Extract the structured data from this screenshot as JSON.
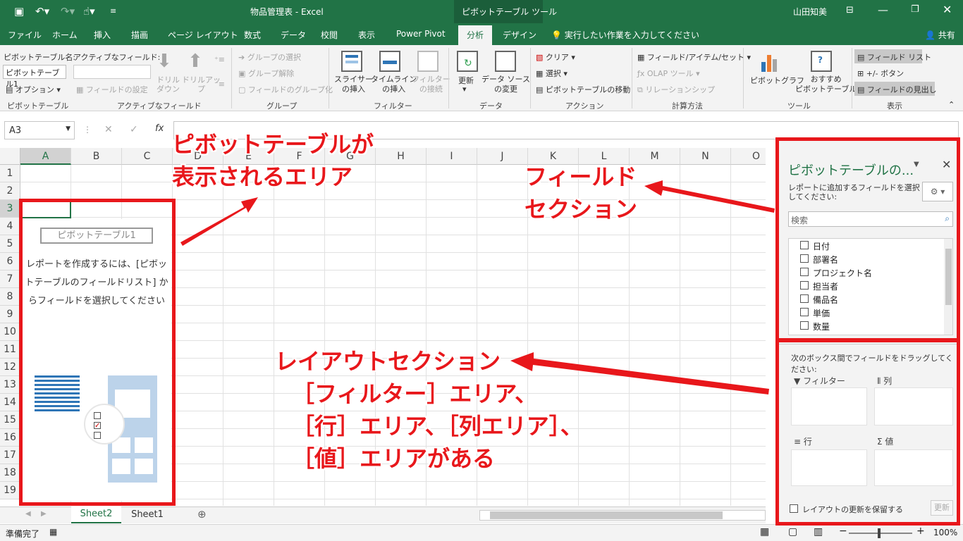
{
  "title": {
    "doc": "物品管理表 - Excel",
    "context": "ピボットテーブル ツール",
    "user": "山田知美"
  },
  "tabs": [
    "ファイル",
    "ホーム",
    "挿入",
    "描画",
    "ページ レイアウト",
    "数式",
    "データ",
    "校閲",
    "表示",
    "Power Pivot",
    "分析",
    "デザイン"
  ],
  "tell_me": "実行したい作業を入力してください",
  "share": "共有",
  "ribbon": {
    "pt_name_label": "ピボットテーブル名:",
    "pt_name_value": "ピボットテーブル1",
    "options": "オプション",
    "active_field_label": "アクティブなフィールド:",
    "field_settings": "フィールドの設定",
    "drill_down": "ドリル\nダウン",
    "drill_up": "ドリルアッ\nプ",
    "group_select": "グループの選択",
    "ungroup": "グループ解除",
    "field_group": "フィールドのグループ化",
    "slicer": "スライサー\nの挿入",
    "timeline": "タイムライン\nの挿入",
    "filter_conn": "フィルター\nの接続",
    "refresh": "更新",
    "change_source": "データ ソース\nの変更",
    "clear": "クリア",
    "select": "選択",
    "move_pt": "ピボットテーブルの移動",
    "fields_items_sets": "フィールド/アイテム/セット",
    "olap_tools": "OLAP ツール",
    "relationships": "リレーションシップ",
    "pivot_chart": "ピボットグラフ",
    "recommended_pt": "おすすめ\nピボットテーブル",
    "field_list": "フィールド リスト",
    "pm_buttons": "+/- ボタン",
    "field_headers": "フィールドの見出し",
    "groups": [
      "ピボットテーブル",
      "アクティブなフィールド",
      "グループ",
      "フィルター",
      "データ",
      "アクション",
      "計算方法",
      "ツール",
      "表示"
    ]
  },
  "formula_bar": {
    "name_box": "A3",
    "fx": "fx"
  },
  "columns": [
    "A",
    "B",
    "C",
    "D",
    "E",
    "F",
    "G",
    "H",
    "I",
    "J",
    "K",
    "L",
    "M",
    "N",
    "O"
  ],
  "rows": [
    "1",
    "2",
    "3",
    "4",
    "5",
    "6",
    "7",
    "8",
    "9",
    "10",
    "11",
    "12",
    "13",
    "14",
    "15",
    "16",
    "17",
    "18",
    "19"
  ],
  "pivot_placeholder": {
    "name": "ピボットテーブル1",
    "instruction": "レポートを作成するには、[ピボットテーブルのフィールドリスト] からフィールドを選択してください"
  },
  "sheets": {
    "active": "Sheet2",
    "other": "Sheet1"
  },
  "status": {
    "ready": "準備完了",
    "zoom": "100%"
  },
  "pane": {
    "title": "ピボットテーブルの...",
    "subtitle": "レポートに追加するフィールドを選択してください:",
    "search_placeholder": "検索",
    "fields": [
      "日付",
      "部署名",
      "プロジェクト名",
      "担当者",
      "備品名",
      "単価",
      "数量"
    ],
    "drag_hint": "次のボックス間でフィールドをドラッグしてください:",
    "areas": {
      "filter": "フィルター",
      "columns": "列",
      "rows": "行",
      "values": "値"
    },
    "defer": "レイアウトの更新を保留する",
    "update": "更新"
  },
  "annotations": {
    "pt_area_1": "ピボットテーブルが",
    "pt_area_2": "表示されるエリア",
    "field_1": "フィールド",
    "field_2": "セクション",
    "layout_1": "レイアウトセクション",
    "layout_2": "［フィルター］エリア、",
    "layout_3": "［行］エリア、［列エリア］、",
    "layout_4": "［値］エリアがある"
  },
  "colors": {
    "excel_green": "#217346",
    "annotation_red": "#e8171b"
  }
}
